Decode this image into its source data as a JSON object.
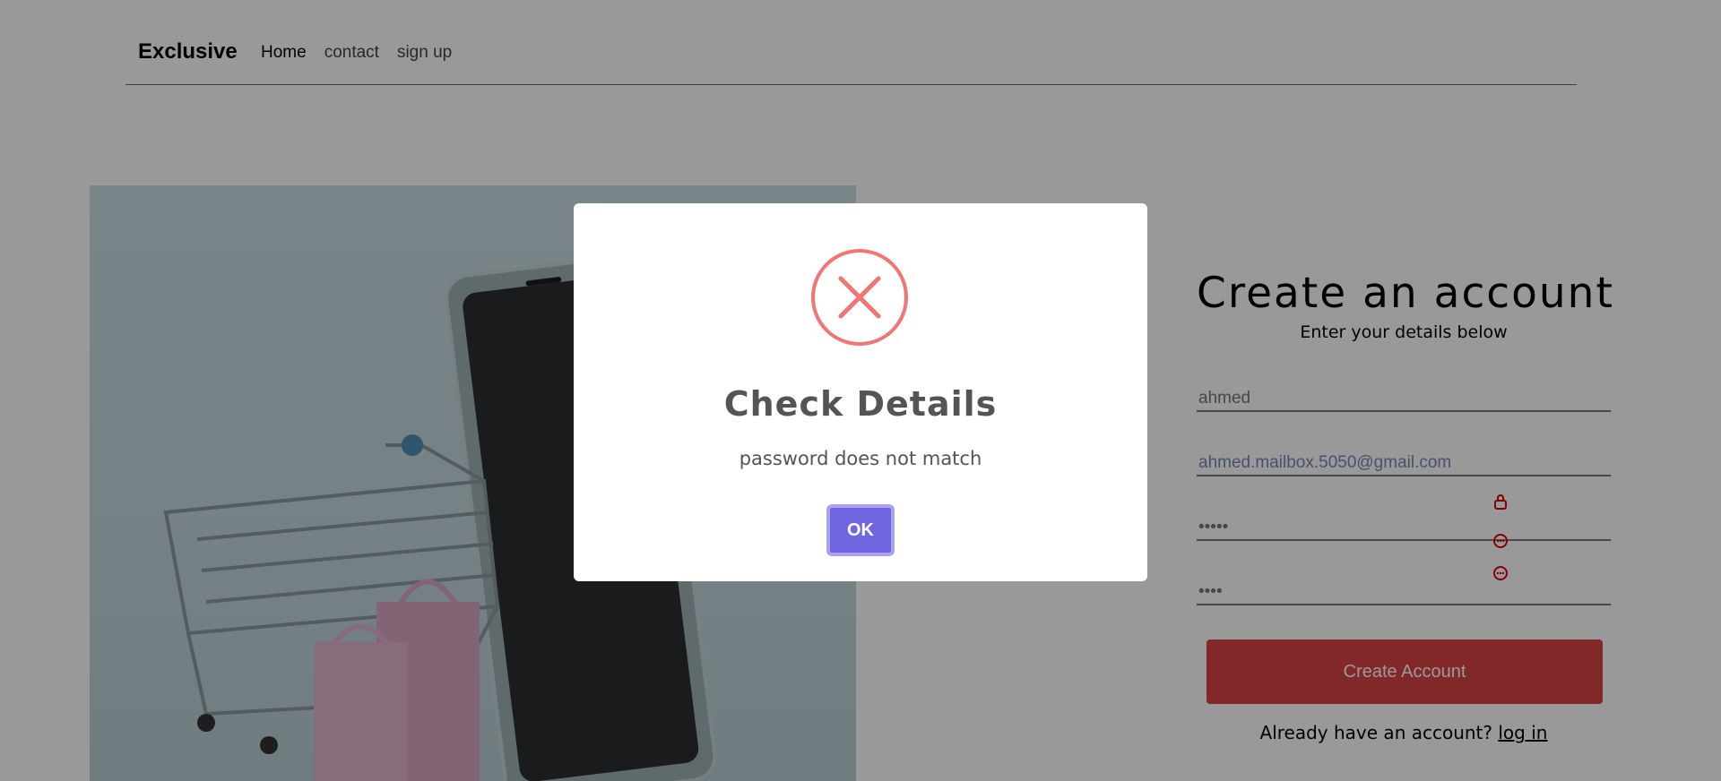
{
  "header": {
    "logo": "Exclusive",
    "nav": [
      "Home",
      "contact",
      "sign up"
    ]
  },
  "signup": {
    "title": "Create an account",
    "subtitle": "Enter your details below",
    "fields": {
      "name": "ahmed",
      "email": "ahmed.mailbox.5050@gmail.com",
      "password": "•••••",
      "confirm": "••••"
    },
    "button": "Create Account",
    "login_prompt": "Already have an account?",
    "login_link": "log in"
  },
  "modal": {
    "title": "Check Details",
    "message": "password does not match",
    "ok": "OK",
    "icon": "error-x-icon",
    "accent": "#f27474",
    "button_color": "#7066e0"
  },
  "colors": {
    "primary": "#db4444"
  }
}
